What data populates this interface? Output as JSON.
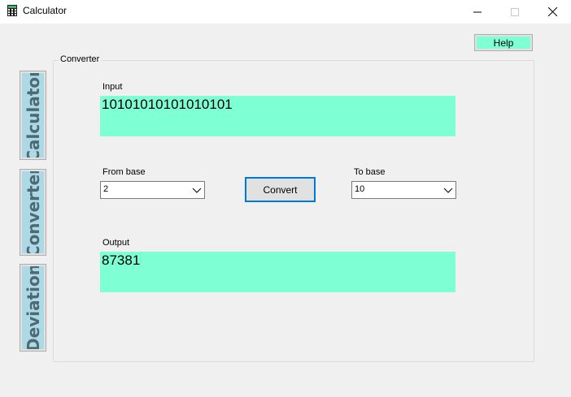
{
  "window": {
    "title": "Calculator",
    "controls": {
      "minimize_icon": "minimize-icon",
      "maximize_icon": "maximize-icon",
      "close_icon": "close-icon"
    }
  },
  "header": {
    "help_label": "Help"
  },
  "side_tabs": [
    {
      "label": "Calculator"
    },
    {
      "label": "Converter"
    },
    {
      "label": "Deviation"
    }
  ],
  "converter": {
    "group_title": "Converter",
    "input_label": "Input",
    "input_value": "10101010101010101",
    "from_base_label": "From base",
    "from_base_value": "2",
    "to_base_label": "To base",
    "to_base_value": "10",
    "convert_label": "Convert",
    "output_label": "Output",
    "output_value": "87381"
  },
  "colors": {
    "accent_field": "#7fffd4",
    "tab_background": "#add8e6",
    "focus_border": "#0078d7"
  }
}
